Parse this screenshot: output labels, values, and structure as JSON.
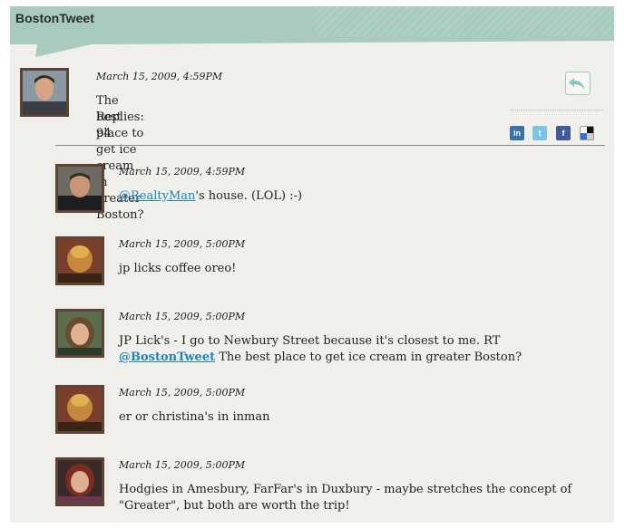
{
  "header": {
    "title": "BostonTweet"
  },
  "main_post": {
    "timestamp": "March 15, 2009, 4:59PM",
    "text": "The best place to get ice cream in greater Boston?",
    "replies": "Replies: 94"
  },
  "share_icons": [
    "linkedin-icon",
    "twitter-icon",
    "facebook-icon",
    "delicious-icon"
  ],
  "replies": [
    {
      "timestamp": "March 15, 2009, 4:59PM",
      "mention": "@RealtyMan",
      "text": "'s house. (LOL) :-)"
    },
    {
      "timestamp": "March 15, 2009, 5:00PM",
      "text": "jp licks coffee oreo!"
    },
    {
      "timestamp": "March 15, 2009, 5:00PM",
      "text_before": "JP Lick's - I go to Newbury Street because it's closest to me. RT ",
      "mention": "@BostonTweet",
      "text_after": " The best place to get ice cream in greater Boston?"
    },
    {
      "timestamp": "March 15, 2009, 5:00PM",
      "text": "er or christina's in inman"
    },
    {
      "timestamp": "March 15, 2009, 5:00PM",
      "text": "Hodgies in Amesbury, FarFar's in Duxbury - maybe stretches the concept of \"Greater\", but both are worth the trip!"
    }
  ],
  "colors": {
    "header_bg": "#a9cbbf",
    "panel_bg": "#f0efeb",
    "link": "#1f86b8",
    "avatar_border": "#5b4433"
  }
}
